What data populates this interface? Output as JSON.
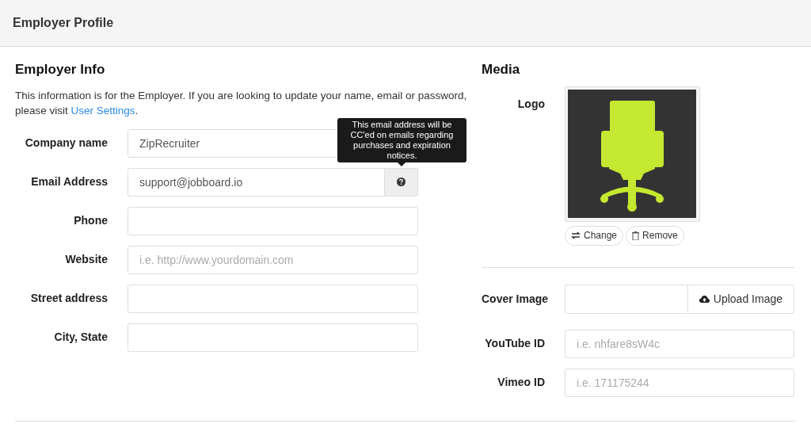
{
  "header": {
    "title": "Employer Profile"
  },
  "employer_info": {
    "heading": "Employer Info",
    "intro": {
      "text": "This information is for the Employer. If you are looking to update your name, email or password, please visit ",
      "link": "User Settings",
      "after": "."
    },
    "fields": [
      {
        "label": "Company name",
        "value": "ZipRecruiter"
      },
      {
        "label": "Email Address",
        "value": "support@jobboard.io",
        "help_button": true,
        "tooltip": "This email address will be CC'ed on emails regarding purchases and expiration notices."
      },
      {
        "label": "Phone"
      },
      {
        "label": "Website",
        "placeholder": "i.e. http://www.yourdomain.com"
      },
      {
        "label": "Street address"
      },
      {
        "label": "City, State"
      }
    ]
  },
  "media": {
    "heading": "Media",
    "logo": {
      "label": "Logo",
      "buttons": [
        "Change",
        "Remove"
      ]
    },
    "cover_image": {
      "label": "Cover Image",
      "button": "Upload Image"
    },
    "fields": [
      {
        "label": "YouTube ID",
        "placeholder": "i.e. nhfare8sW4c"
      },
      {
        "label": "Vimeo ID",
        "placeholder": "i.e. 171175244"
      }
    ]
  }
}
